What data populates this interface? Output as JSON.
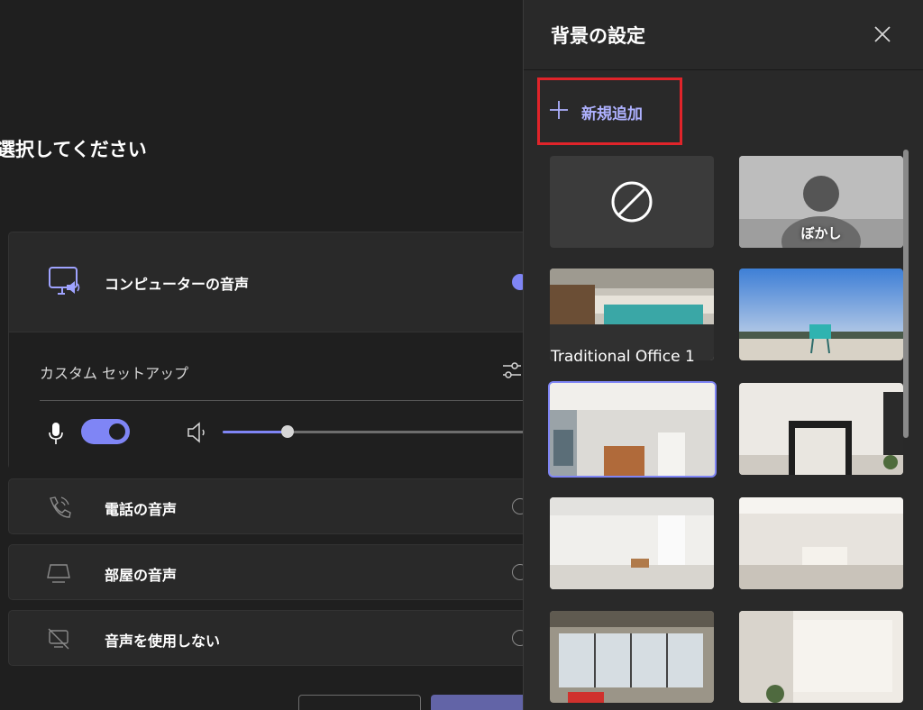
{
  "left": {
    "title": "選択してください",
    "computer_audio": {
      "label": "コンピューターの音声",
      "custom_setup_label": "カスタム セットアップ"
    },
    "phone_audio": {
      "label": "電話の音声"
    },
    "room_audio": {
      "label": "部屋の音声"
    },
    "no_audio": {
      "label": "音声を使用しない"
    },
    "mic_enabled": true,
    "speaker_volume_fraction": 0.18,
    "icons": [
      "monitor-speaker-icon",
      "settings-sliders-icon",
      "microphone-icon",
      "speaker-icon",
      "phone-icon",
      "room-device-icon",
      "no-audio-icon"
    ]
  },
  "panel": {
    "title": "背景の設定",
    "add_new_label": "新規追加",
    "backgrounds": [
      {
        "name": "",
        "type": "none"
      },
      {
        "name": "ぼかし",
        "type": "blur"
      },
      {
        "name": "Traditional Office 1",
        "type": "image"
      },
      {
        "name": "",
        "type": "image"
      },
      {
        "name": "",
        "type": "image",
        "selected": true
      },
      {
        "name": "",
        "type": "image"
      },
      {
        "name": "",
        "type": "image"
      },
      {
        "name": "",
        "type": "image"
      },
      {
        "name": "",
        "type": "image"
      },
      {
        "name": "",
        "type": "image"
      }
    ],
    "colors": {
      "accent": "#7f85f5",
      "highlight": "#e0242a",
      "panel_bg": "#292929"
    }
  }
}
